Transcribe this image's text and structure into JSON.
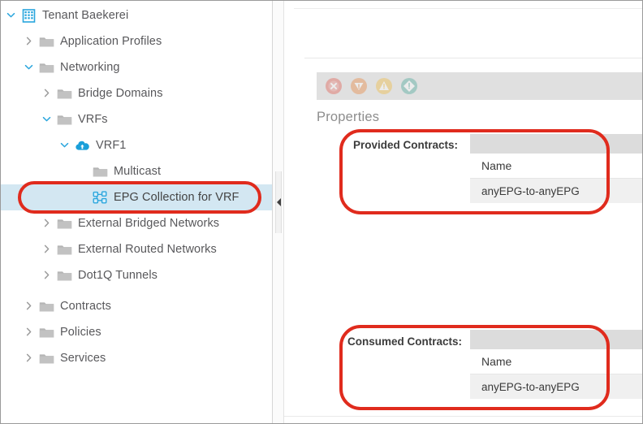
{
  "nav_tree": {
    "items": [
      {
        "label": "Tenant Baekerei",
        "indent": 0,
        "twisty": "chevron-down-icon",
        "icon": "tenant-building-icon",
        "selected": false
      },
      {
        "label": "Application Profiles",
        "indent": 1,
        "twisty": "chevron-right-icon",
        "icon": "folder-icon",
        "selected": false
      },
      {
        "label": "Networking",
        "indent": 1,
        "twisty": "chevron-down-icon",
        "icon": "folder-icon",
        "selected": false
      },
      {
        "label": "Bridge Domains",
        "indent": 2,
        "twisty": "chevron-right-icon",
        "icon": "folder-icon",
        "selected": false
      },
      {
        "label": "VRFs",
        "indent": 2,
        "twisty": "chevron-down-icon",
        "icon": "folder-icon",
        "selected": false
      },
      {
        "label": "VRF1",
        "indent": 3,
        "twisty": "chevron-down-icon",
        "icon": "vrf-cloud-icon",
        "selected": false
      },
      {
        "label": "Multicast",
        "indent": 4,
        "twisty": "none",
        "icon": "folder-icon",
        "selected": false
      },
      {
        "label": "EPG Collection for VRF",
        "indent": 4,
        "twisty": "none",
        "icon": "epg-collection-icon",
        "selected": true
      },
      {
        "label": "External Bridged Networks",
        "indent": 2,
        "twisty": "chevron-right-icon",
        "icon": "folder-icon",
        "selected": false
      },
      {
        "label": "External Routed Networks",
        "indent": 2,
        "twisty": "chevron-right-icon",
        "icon": "folder-icon",
        "selected": false
      },
      {
        "label": "Dot1Q Tunnels",
        "indent": 2,
        "twisty": "chevron-right-icon",
        "icon": "folder-icon",
        "selected": false
      },
      {
        "label": "Contracts",
        "indent": 1,
        "twisty": "chevron-right-icon",
        "icon": "folder-icon",
        "selected": false
      },
      {
        "label": "Policies",
        "indent": 1,
        "twisty": "chevron-right-icon",
        "icon": "folder-icon",
        "selected": false
      },
      {
        "label": "Services",
        "indent": 1,
        "twisty": "chevron-right-icon",
        "icon": "folder-icon",
        "selected": false
      }
    ]
  },
  "splitter": {
    "collapse_icon": "collapse-left-arrow-icon"
  },
  "content": {
    "status_icons": [
      {
        "name": "fault-critical-icon",
        "color": "#e05b4f"
      },
      {
        "name": "fault-major-icon",
        "color": "#e8853c"
      },
      {
        "name": "fault-minor-icon",
        "color": "#f0b93c"
      },
      {
        "name": "fault-warning-icon",
        "color": "#4aa79a"
      }
    ],
    "properties_heading": "Properties",
    "provided_contracts": {
      "label": "Provided Contracts:",
      "columns": [
        "Name"
      ],
      "rows": [
        {
          "name": "anyEPG-to-anyEPG"
        }
      ]
    },
    "consumed_contracts": {
      "label": "Consumed Contracts:",
      "columns": [
        "Name"
      ],
      "rows": [
        {
          "name": "anyEPG-to-anyEPG"
        }
      ]
    }
  },
  "annotations": {
    "highlight_color": "#e02b1d",
    "boxes": [
      {
        "name": "epg-collection-for-vrf-callout"
      },
      {
        "name": "provided-contracts-callout"
      },
      {
        "name": "consumed-contracts-callout"
      }
    ]
  }
}
